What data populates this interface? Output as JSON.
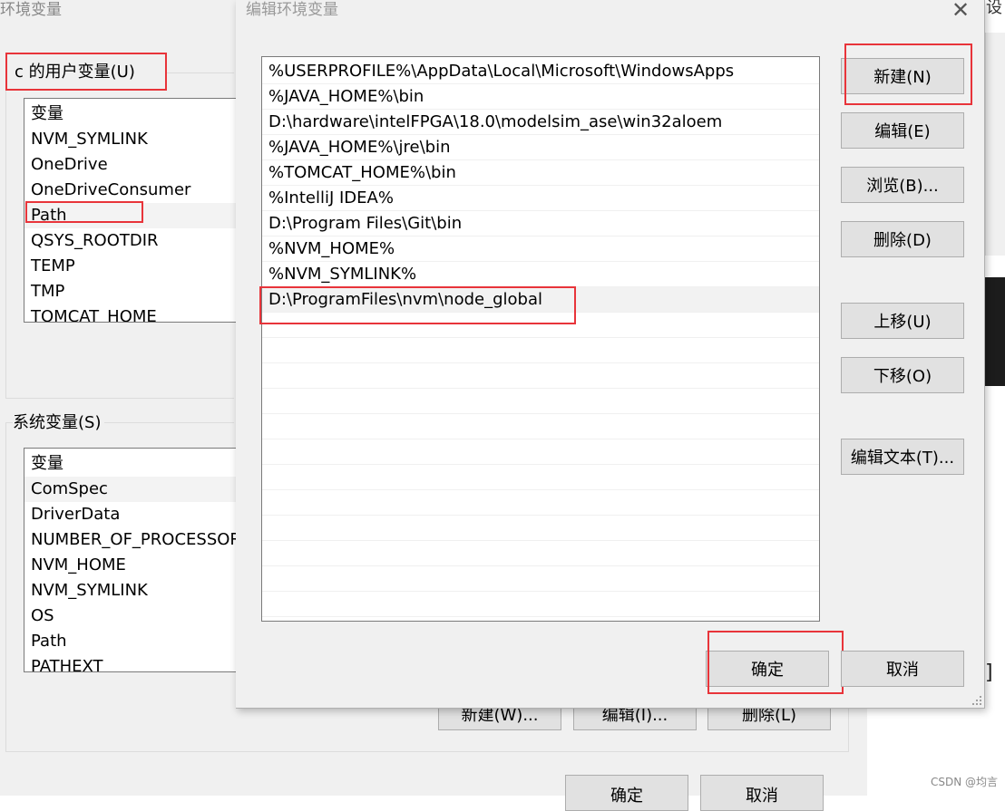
{
  "background_window": {
    "title": "环境变量",
    "user_vars_label": "c 的用户变量(U)",
    "user_vars_header": "变量",
    "user_vars": [
      "NVM_SYMLINK",
      "OneDrive",
      "OneDriveConsumer",
      "Path",
      "QSYS_ROOTDIR",
      "TEMP",
      "TMP",
      "TOMCAT_HOME"
    ],
    "system_vars_label": "系统变量(S)",
    "system_vars_header": "变量",
    "system_vars": [
      "ComSpec",
      "DriverData",
      "NUMBER_OF_PROCESSORS",
      "NVM_HOME",
      "NVM_SYMLINK",
      "OS",
      "Path",
      "PATHEXT"
    ],
    "buttons": {
      "new": "新建(W)...",
      "edit": "编辑(I)...",
      "delete": "删除(L)"
    },
    "bottom_buttons": {
      "ok": "确定",
      "cancel": "取消"
    }
  },
  "right_window": {
    "title_fragment": "设",
    "bracket": "]"
  },
  "dialog": {
    "title": "编辑环境变量",
    "close_glyph": "✕",
    "paths": [
      "%USERPROFILE%\\AppData\\Local\\Microsoft\\WindowsApps",
      "%JAVA_HOME%\\bin",
      "D:\\hardware\\intelFPGA\\18.0\\modelsim_ase\\win32aloem",
      "%JAVA_HOME%\\jre\\bin",
      "%TOMCAT_HOME%\\bin",
      "%IntelliJ IDEA%",
      "D:\\Program Files\\Git\\bin",
      "%NVM_HOME%",
      "%NVM_SYMLINK%",
      "D:\\ProgramFiles\\nvm\\node_global"
    ],
    "side_buttons": {
      "new": "新建(N)",
      "edit": "编辑(E)",
      "browse": "浏览(B)...",
      "delete": "删除(D)",
      "move_up": "上移(U)",
      "move_down": "下移(O)",
      "edit_text": "编辑文本(T)..."
    },
    "ok": "确定",
    "cancel": "取消"
  },
  "watermark": "CSDN @均言",
  "colors": {
    "highlight_box": "#e8343a",
    "dialog_bg": "#f0f0f0",
    "button_bg": "#e1e1e1"
  }
}
